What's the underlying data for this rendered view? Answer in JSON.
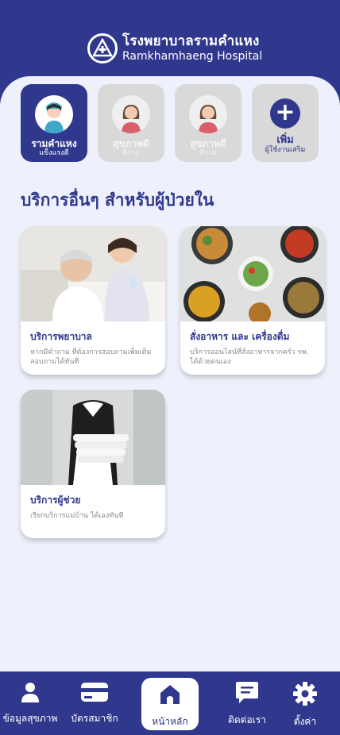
{
  "header": {
    "logo_th": "โรงพยาบาลรามคำแหง",
    "logo_en": "Ramkhamhaeng Hospital"
  },
  "profiles": [
    {
      "name": "รามคำแหง",
      "sub": "แข็งแรงดี",
      "active": true
    },
    {
      "name": "สุขภาพดี",
      "sub": "ที่ราม",
      "active": false
    },
    {
      "name": "สุขภาพดี",
      "sub": "ที่ราม",
      "active": false
    }
  ],
  "add_profile": {
    "label": "เพิ่ม",
    "sub": "ผู้ใช้งานเสริม"
  },
  "section_title": "บริการอื่นๆ สำหรับผู้ป่วยใน",
  "services": [
    {
      "title": "บริการพยาบาล",
      "desc": "หากมีคำถาม ที่ต้องการสอบถามเพิ่มเติม สอบถามได้ทันที"
    },
    {
      "title": "สั่งอาหาร และ เครื่องดื่ม",
      "desc": "บริการออนไลน์ที่สั่งอาหารจากครัว รพ. ได้ด้วยตนเอง"
    },
    {
      "title": "บริการผู้ช่วย",
      "desc": "เรียกบริการแม่บ้าน ได้เองทันที"
    }
  ],
  "nav": [
    {
      "label": "ข้อมูลสุขภาพ",
      "icon": "person-icon"
    },
    {
      "label": "บัตรสมาชิก",
      "icon": "card-icon"
    },
    {
      "label": "หน้าหลัก",
      "icon": "home-icon",
      "active": true
    },
    {
      "label": "ติดต่อเรา",
      "icon": "chat-icon"
    },
    {
      "label": "ตั้งค่า",
      "icon": "gear-icon"
    }
  ],
  "colors": {
    "primary": "#30388e",
    "background": "#eef0fb",
    "inactive": "#d9d9d9"
  }
}
